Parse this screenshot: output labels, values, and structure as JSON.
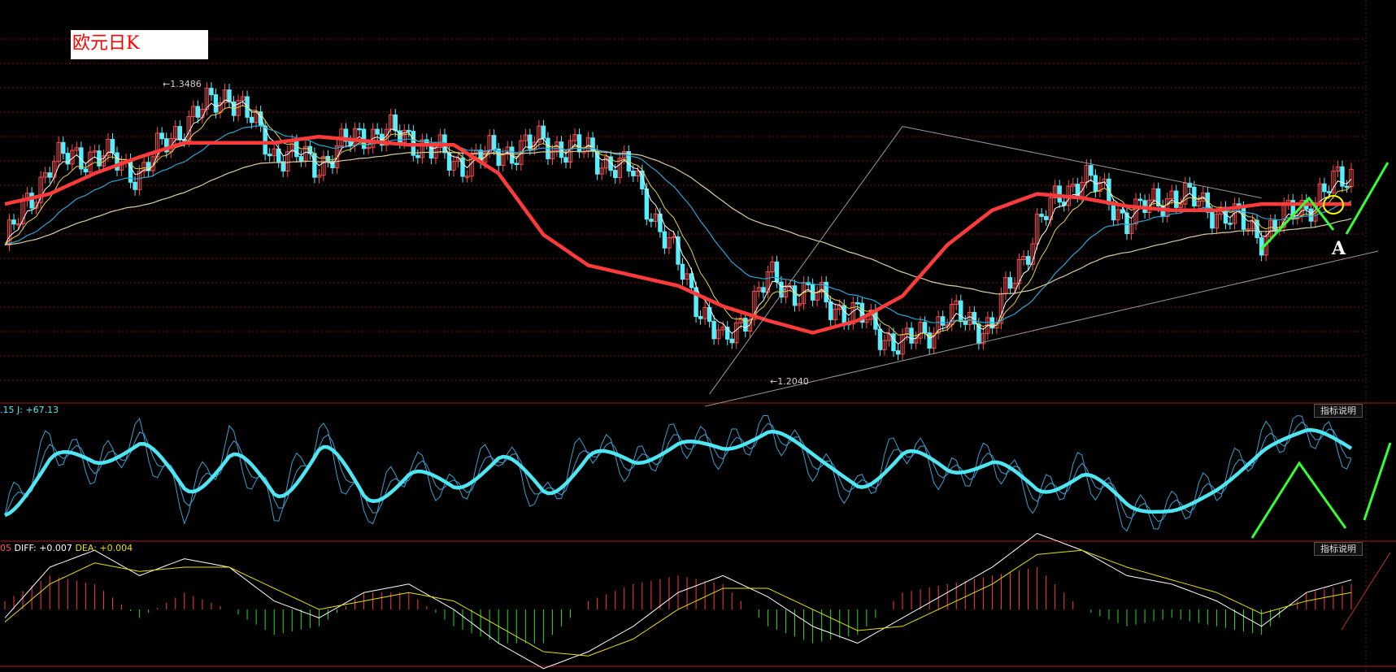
{
  "title": "欧元日K",
  "colors": {
    "background": "#000000",
    "grid": "#7a1010",
    "up_candle": "#ff4d4d",
    "down_candle": "#55f0ff",
    "ma_thick": "#ff3a3a",
    "ma_white": "#ffffff",
    "ma_yellow": "#e8d44a",
    "ma_cyan": "#2aa6d6",
    "ma_long": "#d8d0a0",
    "trendline": "#9a9a9a",
    "kdj_main": "#4ee6f2",
    "kdj_thin": "#3aa0d0",
    "macd_pos": "#ff3b3b",
    "macd_neg": "#22dd22",
    "diff_line": "#ffffff",
    "dea_line": "#e8e000",
    "annotation_green": "#33ff33",
    "annotation_circle": "#ffff00"
  },
  "price_panel": {
    "high_label": "1.3486",
    "low_label": "1.2040",
    "point_label": "A"
  },
  "kdj_panel": {
    "label_prefix": ".15",
    "j_label": "J: +67.13",
    "help_label": "指标说明"
  },
  "macd_panel": {
    "label_prefix": "05",
    "diff_label": "DIFF: +0.007",
    "dea_label": "DEA: +0.004",
    "help_label": "指标说明"
  },
  "chart_data": [
    {
      "type": "candlestick",
      "title": "欧元日K",
      "x": [
        0,
        10,
        20,
        30,
        40,
        50,
        60,
        70,
        80,
        90,
        100,
        110,
        120,
        130,
        140,
        150,
        160,
        170,
        180,
        190,
        200,
        210,
        220,
        230,
        240,
        250,
        260,
        270,
        280,
        290,
        300
      ],
      "close": [
        1.265,
        1.305,
        1.31,
        1.3,
        1.325,
        1.34,
        1.31,
        1.305,
        1.32,
        1.318,
        1.305,
        1.31,
        1.315,
        1.31,
        1.3,
        1.255,
        1.215,
        1.248,
        1.24,
        1.23,
        1.215,
        1.23,
        1.225,
        1.275,
        1.3,
        1.278,
        1.29,
        1.282,
        1.27,
        1.285,
        1.3
      ],
      "annotations": [
        "1.3486",
        "1.2040"
      ],
      "series": [
        {
          "values": [
            1.285,
            1.29,
            1.3,
            1.308,
            1.315,
            1.315,
            1.315,
            1.318,
            1.316,
            1.314,
            1.314,
            1.3,
            1.27,
            1.255,
            1.25,
            1.245,
            1.235,
            1.228,
            1.222,
            1.228,
            1.24,
            1.265,
            1.282,
            1.29,
            1.288,
            1.284,
            1.282,
            1.282,
            1.285
          ]
        }
      ]
    },
    {
      "type": "line",
      "title": "KDJ",
      "x": [
        0,
        10,
        20,
        30,
        40,
        50,
        60,
        70,
        80,
        90,
        100,
        110,
        120,
        130,
        140,
        150,
        160,
        170,
        180,
        190,
        200,
        210,
        220,
        230,
        240,
        250,
        260,
        270,
        280,
        290,
        300
      ],
      "series": [
        {
          "name": "J",
          "values": [
            10,
            80,
            55,
            85,
            20,
            80,
            15,
            90,
            10,
            60,
            30,
            75,
            20,
            80,
            55,
            85,
            70,
            95,
            60,
            30,
            80,
            45,
            65,
            25,
            55,
            10,
            15,
            40,
            80,
            95,
            67.13
          ]
        }
      ],
      "ylim": [
        -10,
        110
      ]
    },
    {
      "type": "bar",
      "title": "MACD",
      "x": [
        0,
        10,
        20,
        30,
        40,
        50,
        60,
        70,
        80,
        90,
        100,
        110,
        120,
        130,
        140,
        150,
        160,
        170,
        180,
        190,
        200,
        210,
        220,
        230,
        240,
        250,
        260,
        270,
        280,
        290,
        300
      ],
      "series": [
        {
          "name": "DIFF",
          "values": [
            -0.002,
            0.01,
            0.014,
            0.008,
            0.012,
            0.01,
            0.002,
            -0.002,
            0.004,
            0.006,
            0.0,
            -0.008,
            -0.014,
            -0.01,
            -0.004,
            0.004,
            0.008,
            0.003,
            -0.004,
            -0.008,
            -0.002,
            0.004,
            0.01,
            0.018,
            0.014,
            0.008,
            0.006,
            0.002,
            -0.004,
            0.004,
            0.007
          ]
        },
        {
          "name": "DEA",
          "values": [
            -0.003,
            0.006,
            0.011,
            0.009,
            0.01,
            0.01,
            0.005,
            0.0,
            0.002,
            0.004,
            0.002,
            -0.004,
            -0.01,
            -0.011,
            -0.007,
            0.0,
            0.005,
            0.005,
            0.0,
            -0.005,
            -0.004,
            0.001,
            0.006,
            0.013,
            0.014,
            0.01,
            0.007,
            0.004,
            -0.001,
            0.002,
            0.004
          ]
        }
      ]
    }
  ]
}
